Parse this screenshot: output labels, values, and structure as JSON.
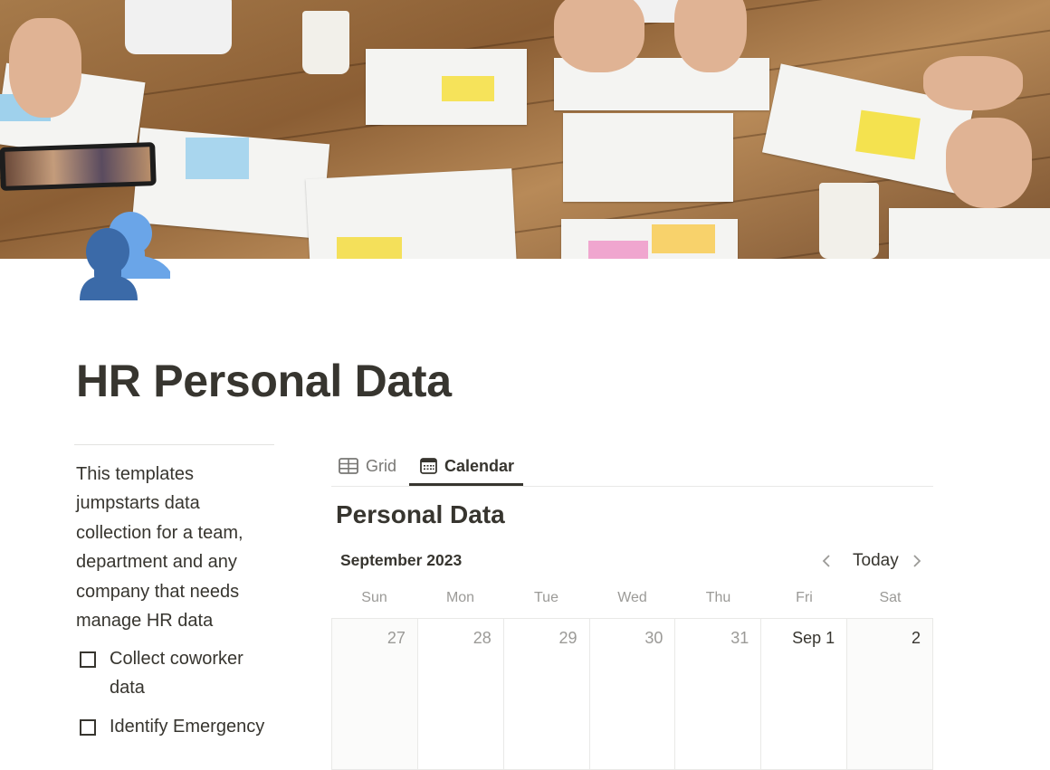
{
  "page": {
    "icon": "busts-in-silhouette-icon",
    "title": "HR Personal Data",
    "cover": "team-working-on-floor-with-papers-photo"
  },
  "sidebar": {
    "description": "This templates jumpstarts data collection for a team, department and any company that needs manage HR data",
    "todos": [
      {
        "label": "Collect coworker data",
        "checked": false
      },
      {
        "label": "Identify Emergency",
        "checked": false
      }
    ]
  },
  "view_tabs": [
    {
      "label": "Grid",
      "icon": "table-grid-icon",
      "active": false
    },
    {
      "label": "Calendar",
      "icon": "calendar-icon",
      "active": true
    }
  ],
  "database": {
    "title": "Personal Data",
    "calendar": {
      "month_label": "September 2023",
      "today_label": "Today",
      "prev_icon": "chevron-left-icon",
      "next_icon": "chevron-right-icon",
      "weekdays": [
        "Sun",
        "Mon",
        "Tue",
        "Wed",
        "Thu",
        "Fri",
        "Sat"
      ],
      "weeks": [
        [
          {
            "label": "27",
            "in_month": false
          },
          {
            "label": "28",
            "in_month": false
          },
          {
            "label": "29",
            "in_month": false
          },
          {
            "label": "30",
            "in_month": false
          },
          {
            "label": "31",
            "in_month": false
          },
          {
            "label": "Sep 1",
            "in_month": true
          },
          {
            "label": "2",
            "in_month": true
          }
        ]
      ]
    }
  }
}
